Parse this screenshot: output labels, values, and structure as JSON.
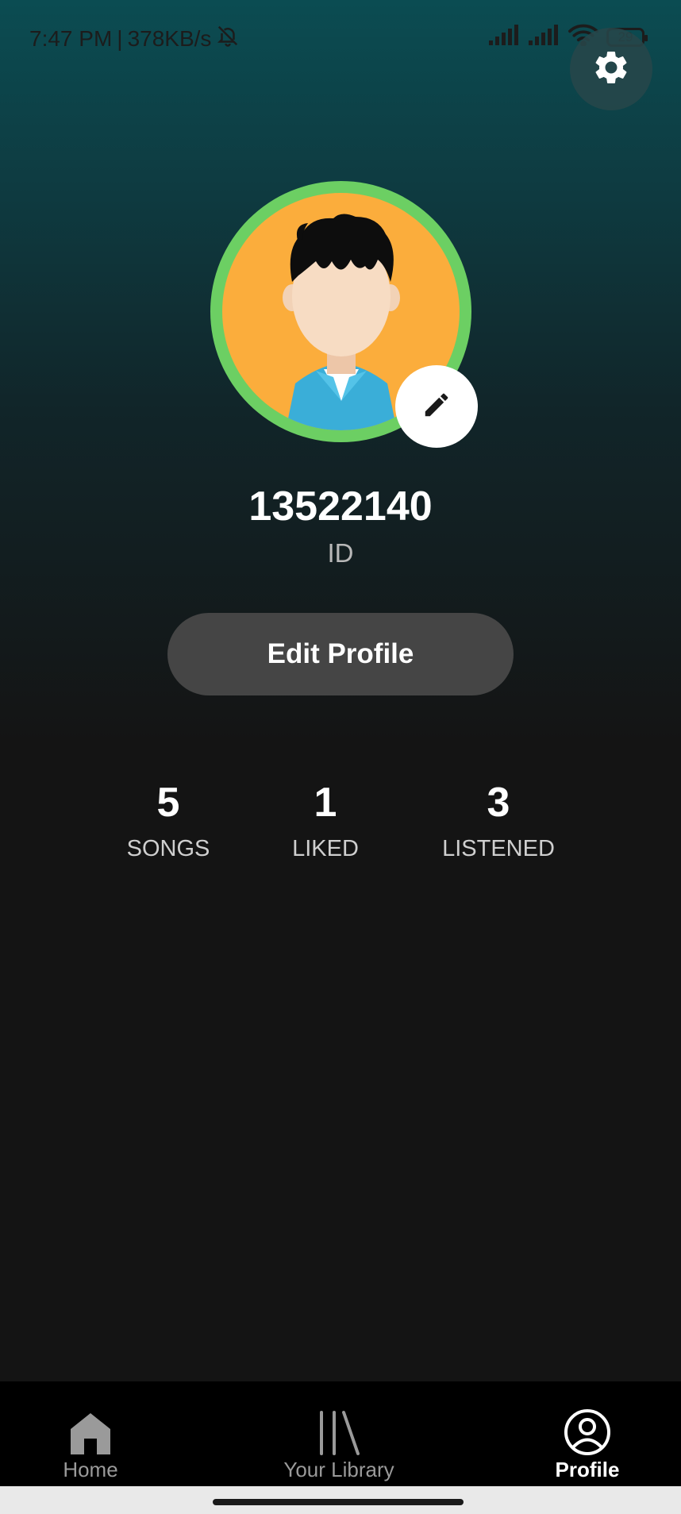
{
  "status_bar": {
    "time": "7:47 PM",
    "network_speed": "378KB/s",
    "battery_level": "29",
    "icons": [
      "bell-off-icon",
      "signal-icon",
      "signal-icon",
      "wifi-icon",
      "battery-icon"
    ]
  },
  "header": {
    "settings_icon": "gear-icon"
  },
  "profile": {
    "avatar": "avatar",
    "edit_avatar_icon": "pencil-icon",
    "user_id": "13522140",
    "user_id_label": "ID",
    "edit_profile_label": "Edit Profile"
  },
  "stats": {
    "songs": {
      "value": "5",
      "label": "SONGS"
    },
    "liked": {
      "value": "1",
      "label": "LIKED"
    },
    "listened": {
      "value": "3",
      "label": "LISTENED"
    }
  },
  "nav": {
    "items": [
      {
        "label": "Home",
        "icon": "home-icon",
        "active": false
      },
      {
        "label": "Your Library",
        "icon": "library-icon",
        "active": false
      },
      {
        "label": "Profile",
        "icon": "profile-icon",
        "active": true
      }
    ]
  },
  "colors": {
    "gradient_top": "#0b4c52",
    "background": "#141414",
    "avatar_ring": "#6ccf63",
    "avatar_fill": "#fbad3c",
    "button": "#454545"
  }
}
